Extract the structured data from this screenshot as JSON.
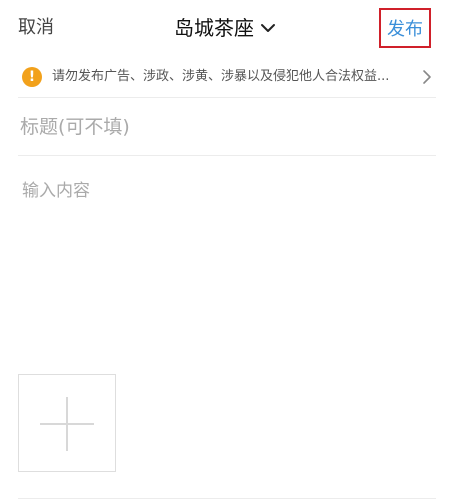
{
  "header": {
    "cancel_label": "取消",
    "board_title": "岛城茶座",
    "board_dropdown_icon": "chevron-down-icon",
    "publish_label": "发布"
  },
  "notice": {
    "icon": "warning-icon",
    "text": "请勿发布广告、涉政、涉黄、涉暴以及侵犯他人合法权益...",
    "arrow_icon": "chevron-right-icon"
  },
  "form": {
    "title_value": "",
    "title_placeholder": "标题(可不填)",
    "content_value": "",
    "content_placeholder": "输入内容",
    "add_image_icon": "plus-icon"
  },
  "colors": {
    "publish_text": "#3a8fd9",
    "publish_highlight_border": "#d0202a",
    "warning_icon": "#f2a11b",
    "placeholder": "#aaaaaa"
  }
}
